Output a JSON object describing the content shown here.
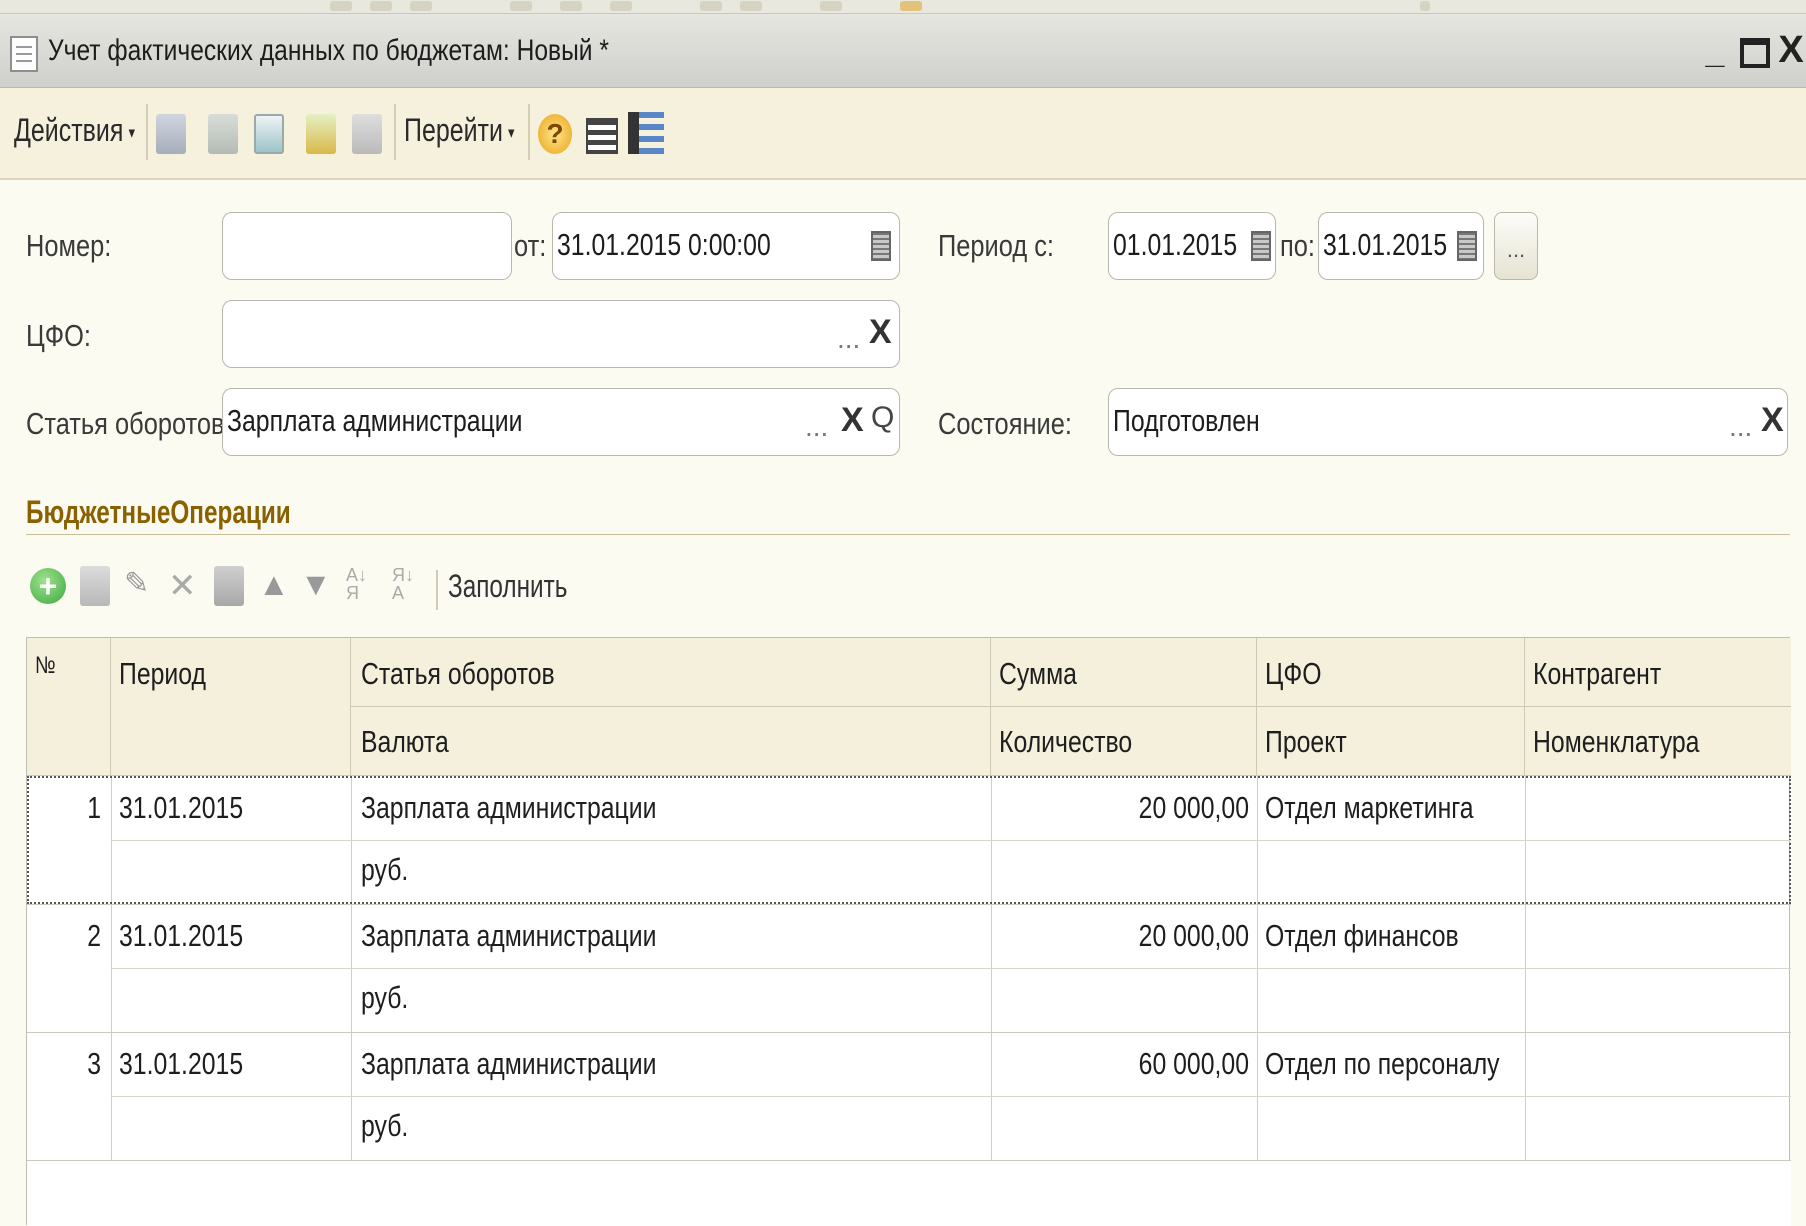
{
  "window": {
    "title": "Учет фактических данных по бюджетам: Новый *",
    "minimize": "_",
    "close": "X"
  },
  "toolbar": {
    "actions_label": "Действия",
    "goto_label": "Перейти",
    "help_icon": "?"
  },
  "form": {
    "number_label": "Номер:",
    "number_value": "",
    "from_label": "от:",
    "from_value": "31.01.2015 0:00:00",
    "period_label": "Период с:",
    "period_from": "01.01.2015",
    "period_to_label": "по:",
    "period_to": "31.01.2015",
    "cfo_label": "ЦФО:",
    "cfo_value": "",
    "article_label": "Статья оборотов:",
    "article_value": "Зарплата администрации",
    "state_label": "Состояние:",
    "state_value": "Подготовлен",
    "dots": "...",
    "x": "X",
    "search": "Q"
  },
  "section": {
    "title": "БюджетныеОперации",
    "fill_label": "Заполнить"
  },
  "table": {
    "headers": {
      "num": "№",
      "period": "Период",
      "article": "Статья оборотов",
      "currency": "Валюта",
      "sum": "Сумма",
      "quantity": "Количество",
      "cfo": "ЦФО",
      "project": "Проект",
      "counterparty": "Контрагент",
      "nomenclature": "Номенклатура"
    },
    "rows": [
      {
        "num": "1",
        "period": "31.01.2015",
        "article": "Зарплата администрации",
        "currency": "руб.",
        "sum": "20 000,00",
        "cfo": "Отдел маркетинга"
      },
      {
        "num": "2",
        "period": "31.01.2015",
        "article": "Зарплата администрации",
        "currency": "руб.",
        "sum": "20 000,00",
        "cfo": "Отдел финансов"
      },
      {
        "num": "3",
        "period": "31.01.2015",
        "article": "Зарплата администрации",
        "currency": "руб.",
        "sum": "60 000,00",
        "cfo": "Отдел по персоналу"
      }
    ]
  },
  "colors": {
    "section_title": "#8a6100",
    "toolbar_bg": "#f5f1dd",
    "add_icon": "#3daa3d"
  }
}
